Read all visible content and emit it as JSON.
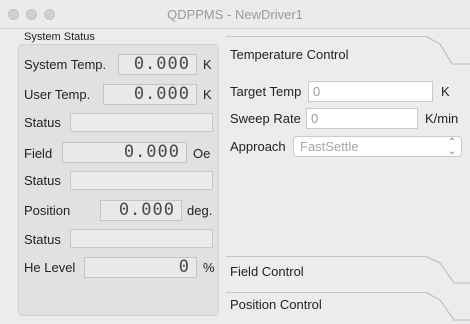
{
  "window": {
    "title": "QDPPMS - NewDriver1"
  },
  "system_status": {
    "title": "System Status",
    "system_temp": {
      "label": "System Temp.",
      "value": "0.000",
      "unit": "K"
    },
    "user_temp": {
      "label": "User Temp.",
      "value": "0.000",
      "unit": "K"
    },
    "temp_status": {
      "label": "Status",
      "value": ""
    },
    "field": {
      "label": "Field",
      "value": "0.000",
      "unit": "Oe"
    },
    "field_status": {
      "label": "Status",
      "value": ""
    },
    "position": {
      "label": "Position",
      "value": "0.000",
      "unit": "deg."
    },
    "position_status": {
      "label": "Status",
      "value": ""
    },
    "he_level": {
      "label": "He Level",
      "value": "0",
      "unit": "%"
    }
  },
  "temperature_control": {
    "title": "Temperature Control",
    "target_temp": {
      "label": "Target Temp",
      "value": "0",
      "unit": "K"
    },
    "sweep_rate": {
      "label": "Sweep Rate",
      "value": "0",
      "unit": "K/min"
    },
    "approach": {
      "label": "Approach",
      "selected": "FastSettle"
    }
  },
  "field_control": {
    "title": "Field Control"
  },
  "position_control": {
    "title": "Position Control"
  },
  "icons": {
    "select_chevron": "chevron-up-down-icon"
  }
}
